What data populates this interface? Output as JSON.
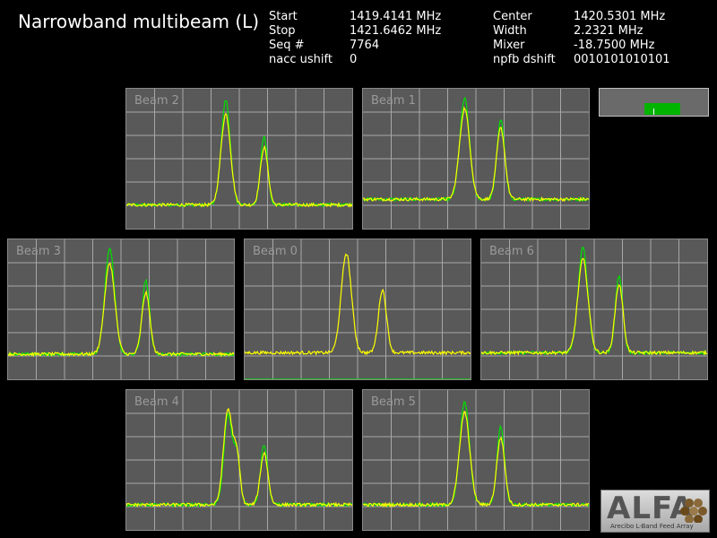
{
  "header": {
    "title": "Narrowband multibeam (L)",
    "left_info": [
      {
        "label": "Start",
        "value": "1419.4141 MHz"
      },
      {
        "label": "Stop",
        "value": "1421.6462 MHz"
      },
      {
        "label": "Seq #",
        "value": "7764"
      },
      {
        "label": "nacc ushift",
        "value": "0"
      }
    ],
    "right_info": [
      {
        "label": "Center",
        "value": "1420.5301 MHz"
      },
      {
        "label": "Width",
        "value": "2.2321 MHz"
      },
      {
        "label": "Mixer",
        "value": "-18.7500 MHz"
      },
      {
        "label": "npfb dshift",
        "value": "0010101010101"
      }
    ]
  },
  "logo": {
    "text": "ALFA",
    "subtitle": "Arecibo L-Band Feed Array"
  },
  "status_indicator": {
    "level": 0.33,
    "color": "#00b400"
  },
  "colors": {
    "pol_a": "#00e000",
    "pol_b": "#ffff00",
    "grid": "#a8a8a8",
    "panel_bg": "#595959"
  },
  "chart_data": [
    {
      "type": "line",
      "title": "Beam 2",
      "xlim": [
        0,
        100
      ],
      "ylim": [
        0,
        100
      ],
      "grid": true,
      "series": [
        {
          "color": "#00e000",
          "baseline": 17,
          "peaks": [
            {
              "x": 44,
              "y": 92,
              "w": 2.8
            },
            {
              "x": 61,
              "y": 66,
              "w": 2.2
            }
          ]
        },
        {
          "color": "#ffff00",
          "baseline": 17,
          "peaks": [
            {
              "x": 44,
              "y": 82,
              "w": 3.0
            },
            {
              "x": 61,
              "y": 58,
              "w": 2.4
            }
          ]
        }
      ]
    },
    {
      "type": "line",
      "title": "Beam 1",
      "xlim": [
        0,
        100
      ],
      "ylim": [
        0,
        100
      ],
      "grid": true,
      "series": [
        {
          "color": "#00e000",
          "baseline": 21,
          "peaks": [
            {
              "x": 45,
              "y": 93,
              "w": 3.0
            },
            {
              "x": 61,
              "y": 78,
              "w": 2.4
            }
          ]
        },
        {
          "color": "#ffff00",
          "baseline": 21,
          "peaks": [
            {
              "x": 45,
              "y": 86,
              "w": 3.2
            },
            {
              "x": 61,
              "y": 72,
              "w": 2.6
            }
          ]
        }
      ]
    },
    {
      "type": "line",
      "title": "Beam 3",
      "xlim": [
        0,
        100
      ],
      "ylim": [
        0,
        100
      ],
      "grid": true,
      "series": [
        {
          "color": "#00e000",
          "baseline": 18,
          "peaks": [
            {
              "x": 45,
              "y": 94,
              "w": 3.0
            },
            {
              "x": 61,
              "y": 71,
              "w": 2.3
            }
          ]
        },
        {
          "color": "#ffff00",
          "baseline": 18,
          "peaks": [
            {
              "x": 45,
              "y": 83,
              "w": 3.2
            },
            {
              "x": 61,
              "y": 62,
              "w": 2.5
            }
          ]
        }
      ]
    },
    {
      "type": "line",
      "title": "Beam 0",
      "xlim": [
        0,
        100
      ],
      "ylim": [
        0,
        100
      ],
      "grid": true,
      "series": [
        {
          "color": "#00e000",
          "baseline": 0,
          "peaks": []
        },
        {
          "color": "#ffff00",
          "baseline": 19,
          "peaks": [
            {
              "x": 45,
              "y": 90,
              "w": 3.2
            },
            {
              "x": 61,
              "y": 64,
              "w": 2.5
            }
          ]
        }
      ]
    },
    {
      "type": "line",
      "title": "Beam 6",
      "xlim": [
        0,
        100
      ],
      "ylim": [
        0,
        100
      ],
      "grid": true,
      "series": [
        {
          "color": "#00e000",
          "baseline": 19,
          "peaks": [
            {
              "x": 45,
              "y": 94,
              "w": 3.0
            },
            {
              "x": 61,
              "y": 74,
              "w": 2.3
            }
          ]
        },
        {
          "color": "#ffff00",
          "baseline": 19,
          "peaks": [
            {
              "x": 45,
              "y": 86,
              "w": 3.2
            },
            {
              "x": 61,
              "y": 68,
              "w": 2.5
            }
          ]
        }
      ]
    },
    {
      "type": "line",
      "title": "Beam 4",
      "xlim": [
        0,
        100
      ],
      "ylim": [
        0,
        100
      ],
      "grid": true,
      "series": [
        {
          "color": "#00e000",
          "baseline": 18,
          "peaks": [
            {
              "x": 45,
              "y": 82,
              "w": 2.6
            },
            {
              "x": 49,
              "y": 52,
              "w": 2.0
            },
            {
              "x": 61,
              "y": 61,
              "w": 2.2
            }
          ]
        },
        {
          "color": "#ffff00",
          "baseline": 18,
          "peaks": [
            {
              "x": 45,
              "y": 86,
              "w": 2.8
            },
            {
              "x": 49,
              "y": 50,
              "w": 2.0
            },
            {
              "x": 61,
              "y": 55,
              "w": 2.4
            }
          ]
        }
      ]
    },
    {
      "type": "line",
      "title": "Beam 5",
      "xlim": [
        0,
        100
      ],
      "ylim": [
        0,
        100
      ],
      "grid": true,
      "series": [
        {
          "color": "#00e000",
          "baseline": 18,
          "peaks": [
            {
              "x": 45,
              "y": 92,
              "w": 3.0
            },
            {
              "x": 61,
              "y": 74,
              "w": 2.3
            }
          ]
        },
        {
          "color": "#ffff00",
          "baseline": 18,
          "peaks": [
            {
              "x": 45,
              "y": 84,
              "w": 3.2
            },
            {
              "x": 61,
              "y": 66,
              "w": 2.5
            }
          ]
        }
      ]
    }
  ]
}
